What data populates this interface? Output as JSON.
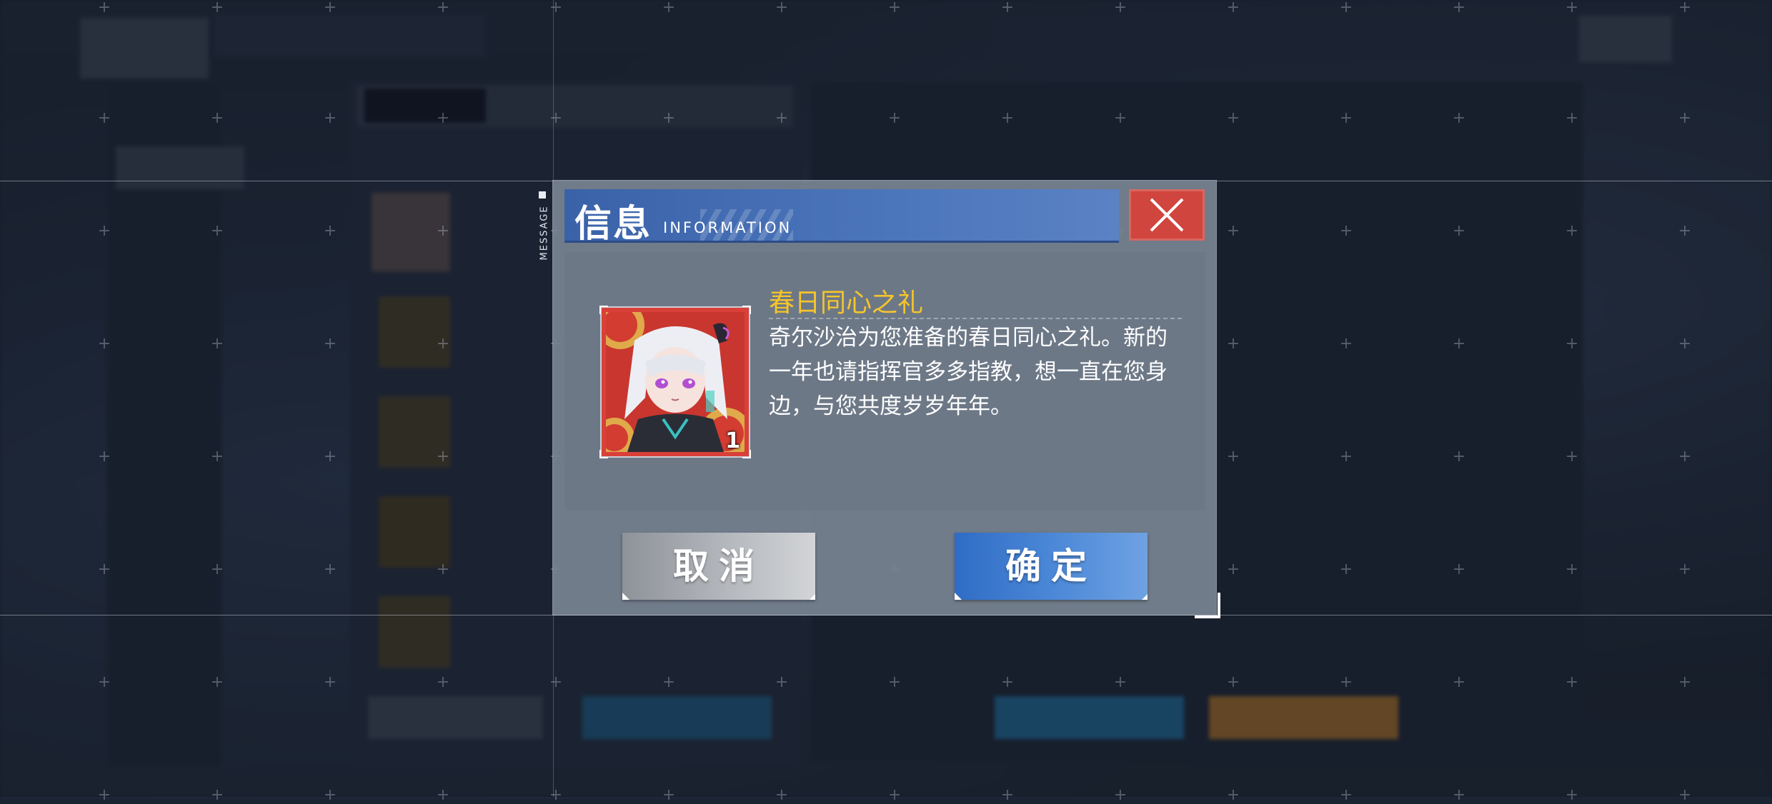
{
  "dialog": {
    "side_label": "MESSAGE",
    "title_zh": "信息",
    "title_en": "INFORMATION",
    "item": {
      "name": "春日同心之礼",
      "count": "1",
      "description": "奇尔沙治为您准备的春日同心之礼。新的一年也请指挥官多多指教，想一直在您身边，与您共度岁岁年年。"
    },
    "buttons": {
      "cancel": "取消",
      "confirm": "确定"
    }
  },
  "colors": {
    "title_bar": "#4c76bc",
    "close_button": "#d0453e",
    "item_name": "#f5c52a",
    "confirm_button": "#3f7ccf",
    "cancel_button": "#a9acb2"
  },
  "icons": {
    "close": "close-x-icon",
    "back": "back-arrow-icon"
  }
}
